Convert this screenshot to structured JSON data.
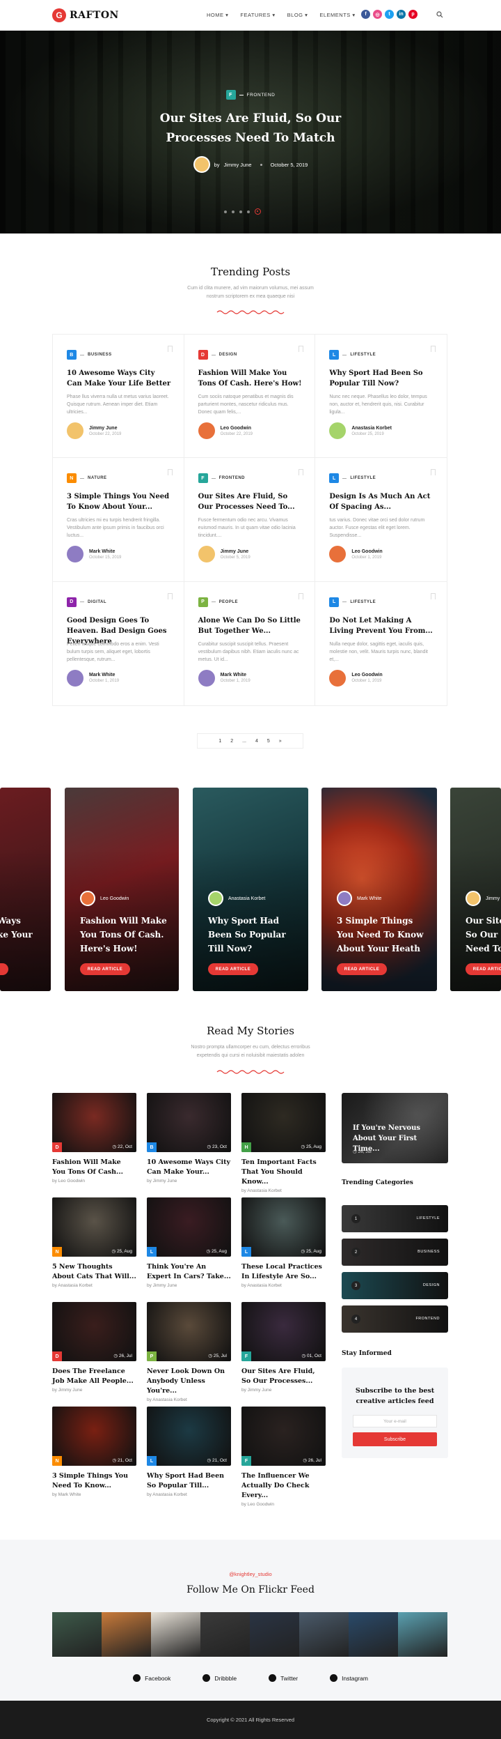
{
  "header": {
    "logo_letter": "G",
    "logo_text": "RAFTON",
    "nav": [
      "HOME",
      "FEATURES",
      "BLOG",
      "ELEMENTS"
    ],
    "socials": [
      {
        "icon": "facebook-icon",
        "glyph": "f",
        "color": "#3b5998"
      },
      {
        "icon": "dribbble-icon",
        "glyph": "◎",
        "color": "#ea4c89"
      },
      {
        "icon": "twitter-icon",
        "glyph": "t",
        "color": "#1da1f2"
      },
      {
        "icon": "linkedin-icon",
        "glyph": "in",
        "color": "#0e76a8"
      },
      {
        "icon": "pinterest-icon",
        "glyph": "p",
        "color": "#e60023"
      }
    ]
  },
  "hero": {
    "badge": "F",
    "category": "FRONTEND",
    "title": "Our Sites Are Fluid, So Our Processes Need To Match",
    "by": "by",
    "author": "Jimmy June",
    "date": "October 5, 2019"
  },
  "trending": {
    "title": "Trending Posts",
    "subtitle": "Cum id clita munere, ad vim maiorum volumus, mei assum nostrum scriptorem ex mea quaeque nisi",
    "cards": [
      {
        "letter": "B",
        "color": "#1e88e5",
        "category": "BUSINESS",
        "title": "10 Awesome Ways City Can Make Your Life Better",
        "excerpt": "Phase llus viverra nulla ut metus varius laoreet. Quisque rutrum. Aenean imper diet. Etiam ultricies...",
        "author": "Jimmy June",
        "date": "October 22, 2019",
        "av": "#f2c36b"
      },
      {
        "letter": "D",
        "color": "#e53935",
        "category": "DESIGN",
        "title": "Fashion Will Make You Tons Of Cash. Here's How!",
        "excerpt": "Cum sociis natoque penatibus et magnis dis parturient montes, nascetur ridiculus mus. Donec quam felis,...",
        "author": "Leo Goodwin",
        "date": "October 22, 2019",
        "av": "#e8703a"
      },
      {
        "letter": "L",
        "color": "#1e88e5",
        "category": "LIFESTYLE",
        "title": "Why Sport Had Been So Popular Till Now?",
        "excerpt": "Nunc nec neque. Phasellus leo dolor, tempus non, auctor et, hendrerit quis, nisi. Curabitur ligula...",
        "author": "Anastasia Korbet",
        "date": "October 25, 2019",
        "av": "#a5d46a"
      },
      {
        "letter": "N",
        "color": "#fb8c00",
        "category": "NATURE",
        "title": "3 Simple Things You Need To Know About Your...",
        "excerpt": "Cras ultricies mi eu turpis hendrerit fringilla. Vestibulum ante ipsum primis in faucibus orci luctus...",
        "author": "Mark White",
        "date": "October 15, 2019",
        "av": "#8e7cc3"
      },
      {
        "letter": "F",
        "color": "#26a69a",
        "category": "FRONTEND",
        "title": "Our Sites Are Fluid, So Our Processes Need To...",
        "excerpt": "Fusce fermentum odio nec arcu. Vivamus euismod mauris. In ut quam vitae odio lacinia tincidunt....",
        "author": "Jimmy June",
        "date": "October 5, 2019",
        "av": "#f2c36b"
      },
      {
        "letter": "L",
        "color": "#1e88e5",
        "category": "LIFESTYLE",
        "title": "Design Is As Much An Act Of Spacing As...",
        "excerpt": "tus varius. Donec vitae orci sed dolor rutrum auctor. Fusce egestas elit eget lorem. Suspendisse...",
        "author": "Leo Goodwin",
        "date": "October 1, 2019",
        "av": "#e8703a"
      },
      {
        "letter": "D",
        "color": "#8e24aa",
        "category": "DIGITAL",
        "title": "Good Design Goes To Heaven. Bad Design Goes Everywhere",
        "excerpt": "Pellen tesque commodo eros a enim. Vesti bulum turpis sem, aliquet eget, lobortis pellentesque, rutrum...",
        "author": "Mark White",
        "date": "October 1, 2019",
        "av": "#8e7cc3"
      },
      {
        "letter": "P",
        "color": "#7cb342",
        "category": "PEOPLE",
        "title": "Alone We Can Do So Little But Together We...",
        "excerpt": "Curabitur suscipit suscipit tellus. Praesent vestibulum dapibus nibh. Etiam iaculis nunc ac metus. Ut id...",
        "author": "Mark White",
        "date": "October 1, 2019",
        "av": "#8e7cc3"
      },
      {
        "letter": "L",
        "color": "#1e88e5",
        "category": "LIFESTYLE",
        "title": "Do Not Let Making A Living Prevent You From...",
        "excerpt": "Nulla neque dolor, sagittis eget, iaculis quis, molestie non, velit. Mauris turpis nunc, blandit et,...",
        "author": "Leo Goodwin",
        "date": "October 1, 2019",
        "av": "#e8703a"
      }
    ]
  },
  "pagination": [
    "1",
    "2",
    "...",
    "4",
    "5",
    "»"
  ],
  "carousel": {
    "button": "READ ARTICLE",
    "partial_left": {
      "title": "Ways\nke Your",
      "bg": "#4a1a1c"
    },
    "slides": [
      {
        "author": "Leo Goodwin",
        "title": "Fashion Will Make You Tons Of Cash. Here's How!",
        "bg1": "#6b1a1e",
        "bg2": "#2a1a1a",
        "av": "#e8703a"
      },
      {
        "author": "Anastasia Korbet",
        "title": "Why Sport Had Been So Popular Till Now?",
        "bg1": "#1d4a4f",
        "bg2": "#0d1a1c",
        "av": "#a5d46a"
      },
      {
        "author": "Mark White",
        "title": "3 Simple Things You Need To Know About Your Heath",
        "bg1": "#c8442a",
        "bg2": "#1a2a3a",
        "av": "#8e7cc3"
      }
    ],
    "partial_right": {
      "author": "Jimmy",
      "title": "Our Sites\nSo Our P\nNeed To",
      "bg": "#2a322a",
      "av": "#f2c36b"
    }
  },
  "stories": {
    "title": "Read My Stories",
    "subtitle": "Nostro prompta ullamcorper eu cum, delectus erroribus expetendis qui cursi ei noluisibit maiestatis adolen",
    "items": [
      {
        "letter": "D",
        "color": "#e53935",
        "date": "22, Oct",
        "title": "Fashion Will Make You Tons Of Cash...",
        "by": "by Leo Goodwin",
        "bg": "#7a2a22"
      },
      {
        "letter": "B",
        "color": "#1e88e5",
        "date": "23, Oct",
        "title": "10 Awesome Ways City Can Make Your...",
        "by": "by Jimmy June",
        "bg": "#3a2a2e"
      },
      {
        "letter": "H",
        "color": "#43a047",
        "date": "25, Aug",
        "title": "Ten Important Facts That You Should Know...",
        "by": "by Anastasia Korbet",
        "bg": "#2e2a22"
      },
      {
        "letter": "N",
        "color": "#fb8c00",
        "date": "25, Aug",
        "title": "5 New Thoughts About Cats That Will...",
        "by": "by Anastasia Korbet",
        "bg": "#5a5348"
      },
      {
        "letter": "L",
        "color": "#1e88e5",
        "date": "25, Aug",
        "title": "Think You're An Expert In Cars? Take...",
        "by": "by Jimmy June",
        "bg": "#3a1c22"
      },
      {
        "letter": "L",
        "color": "#1e88e5",
        "date": "25, Aug",
        "title": "These Local Practices In Lifestyle Are So...",
        "by": "by Anastasia Korbet",
        "bg": "#4a5a58"
      },
      {
        "letter": "D",
        "color": "#e53935",
        "date": "26, Jul",
        "title": "Does The Freelance Job Make All People...",
        "by": "by Jimmy June",
        "bg": "#3a1e1c"
      },
      {
        "letter": "P",
        "color": "#7cb342",
        "date": "25, Jul",
        "title": "Never Look Down On Anybody Unless You're...",
        "by": "by Anastasia Korbet",
        "bg": "#5a4a3a"
      },
      {
        "letter": "F",
        "color": "#26a69a",
        "date": "01, Oct",
        "title": "Our Sites Are Fluid, So Our Processes...",
        "by": "by Jimmy June",
        "bg": "#3a2a3e"
      },
      {
        "letter": "N",
        "color": "#fb8c00",
        "date": "21, Oct",
        "title": "3 Simple Things You Need To Know...",
        "by": "by Mark White",
        "bg": "#7a2012"
      },
      {
        "letter": "L",
        "color": "#1e88e5",
        "date": "21, Oct",
        "title": "Why Sport Had Been So Popular Till...",
        "by": "by Anastasia Korbet",
        "bg": "#1c3a44"
      },
      {
        "letter": "F",
        "color": "#26a69a",
        "date": "26, Jul",
        "title": "The Influencer We Actually Do Check Every...",
        "by": "by Leo Goodwin",
        "bg": "#2a2220"
      }
    ]
  },
  "sidebar": {
    "featured_title": "If You're Nervous About Your First Time...",
    "featured_date": "26, Jul",
    "trending_heading": "Trending Categories",
    "categories": [
      {
        "n": "1",
        "label": "LIFESTYLE",
        "bg": "#3a3a3a"
      },
      {
        "n": "2",
        "label": "BUSINESS",
        "bg": "#2e2a2a"
      },
      {
        "n": "3",
        "label": "DESIGN",
        "bg": "#1c4a52"
      },
      {
        "n": "4",
        "label": "FRONTEND",
        "bg": "#3a342e"
      }
    ],
    "stay_heading": "Stay Informed",
    "subscribe_title": "Subscribe to the best creative articles feed",
    "email_placeholder": "Your e-mail",
    "subscribe_button": "Subscribe"
  },
  "flickr": {
    "handle": "@knightley_studio",
    "title": "Follow Me On Flickr Feed",
    "photos": [
      "#3d5a4a",
      "#c87a3a",
      "#e8e2d8",
      "#3a3a3a",
      "#2a3444",
      "#4a5a6a",
      "#2a4a6a",
      "#5aa0b0"
    ]
  },
  "follow": [
    {
      "icon": "facebook-icon",
      "label": "Facebook"
    },
    {
      "icon": "dribbble-icon",
      "label": "Dribbble"
    },
    {
      "icon": "twitter-icon",
      "label": "Twitter"
    },
    {
      "icon": "instagram-icon",
      "label": "Instagram"
    }
  ],
  "footer": {
    "copyright": "Copyright © 2021 All Rights Reserved"
  }
}
